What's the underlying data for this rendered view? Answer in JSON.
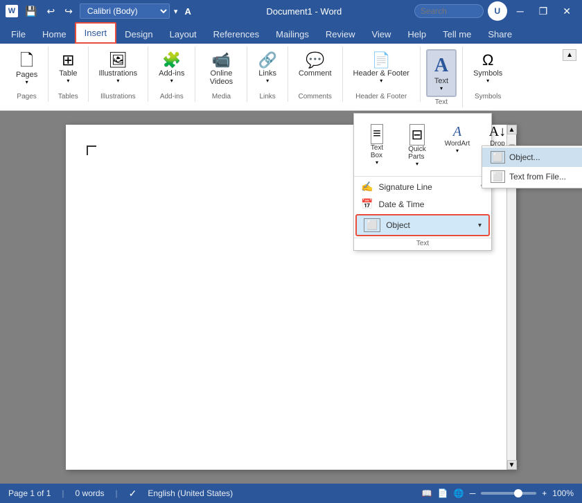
{
  "titleBar": {
    "appIcon": "W",
    "undoLabel": "↩",
    "redoLabel": "↪",
    "fontName": "Calibri (Body)",
    "fontDropArrow": "▾",
    "formatIcon": "A",
    "docTitle": "Document1 - Word",
    "searchPlaceholder": "Search",
    "userLabel": "User",
    "minimizeBtn": "─",
    "restoreBtn": "❐",
    "closeBtn": "✕"
  },
  "ribbon": {
    "tabs": [
      "File",
      "Home",
      "Insert",
      "Design",
      "Layout",
      "References",
      "Mailings",
      "Review",
      "View",
      "Help",
      "Tell me",
      "Share"
    ],
    "activeTab": "Insert",
    "groups": {
      "pages": {
        "label": "Pages",
        "buttons": [
          {
            "icon": "🗋",
            "label": "Pages"
          }
        ]
      },
      "tables": {
        "label": "Tables",
        "buttons": [
          {
            "icon": "⊞",
            "label": "Table"
          }
        ]
      },
      "illustrations": {
        "label": "Illustrations"
      },
      "addIns": {
        "label": "Add-ins"
      },
      "media": {
        "label": "Media"
      },
      "links": {
        "label": "Links"
      },
      "comments": {
        "label": "Comments"
      },
      "headerFooter": {
        "label": "Header & Footer"
      },
      "text": {
        "label": "Text",
        "active": true
      },
      "symbols": {
        "label": "Symbols"
      }
    }
  },
  "textDropdown": {
    "items": [
      {
        "icon": "≡",
        "label": "Text\nBox"
      },
      {
        "icon": "⊟",
        "label": "Quick\nParts"
      },
      {
        "icon": "A",
        "label": "WordArt"
      },
      {
        "icon": "A↓",
        "label": "Drop\nCap"
      }
    ],
    "rightItems": [
      {
        "label": "Signature Line",
        "hasArrow": true
      },
      {
        "label": "Date & Time"
      },
      {
        "label": "Object",
        "hasArrow": true,
        "highlighted": true
      }
    ],
    "groupLabel": "Text"
  },
  "objectDropdown": {
    "items": [
      {
        "label": "Object...",
        "highlighted": true
      },
      {
        "label": "Text from File..."
      }
    ]
  },
  "document": {
    "pageNumber": "Page 1 of 1",
    "wordCount": "0 words",
    "language": "English (United States)",
    "zoom": "100%"
  }
}
